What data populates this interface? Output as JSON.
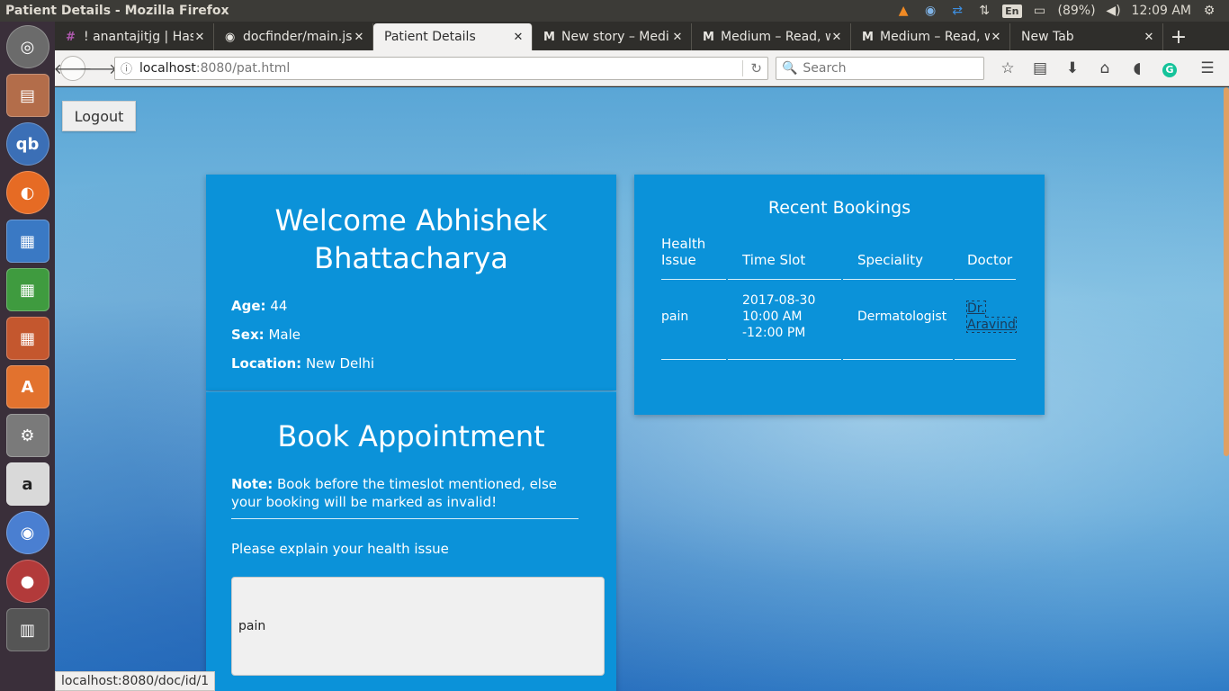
{
  "window_title": "Patient Details - Mozilla Firefox",
  "tray": {
    "lang": "En",
    "battery": "(89%)",
    "time": "12:09 AM"
  },
  "tabs": [
    {
      "icon": "#",
      "label": "! anantajitjg | Has"
    },
    {
      "icon": "◉",
      "label": "docfinder/main.js"
    },
    {
      "icon": "",
      "label": "Patient Details"
    },
    {
      "icon": "M",
      "label": "New story – Medi"
    },
    {
      "icon": "M",
      "label": "Medium – Read, w"
    },
    {
      "icon": "M",
      "label": "Medium – Read, w"
    },
    {
      "icon": "",
      "label": "New Tab"
    }
  ],
  "url": {
    "host": "localhost",
    "path": ":8080/pat.html"
  },
  "search": {
    "placeholder": "Search"
  },
  "page": {
    "logout_label": "Logout",
    "welcome": "Welcome Abhishek Bhattacharya",
    "profile": {
      "age_label": "Age:",
      "age": "44",
      "sex_label": "Sex:",
      "sex": "Male",
      "location_label": "Location:",
      "location": "New Delhi"
    },
    "book": {
      "title": "Book Appointment",
      "note_label": "Note:",
      "note": "Book before the timeslot mentioned, else your booking will be marked as invalid!",
      "issue_label": "Please explain your health issue",
      "issue_value": "pain"
    },
    "bookings": {
      "title": "Recent Bookings",
      "headers": [
        "Health Issue",
        "Time Slot",
        "Speciality",
        "Doctor"
      ],
      "rows": [
        {
          "issue": "pain",
          "date": "2017-08-30",
          "time": "10:00 AM -12:00 PM",
          "speciality": "Dermatologist",
          "doctor": "Dr. Aravind"
        }
      ]
    }
  },
  "status_url": "localhost:8080/doc/id/1",
  "colors": {
    "card": "#0b92d9",
    "panel": "#3c3b37",
    "launcher": "#3a2f3a"
  }
}
